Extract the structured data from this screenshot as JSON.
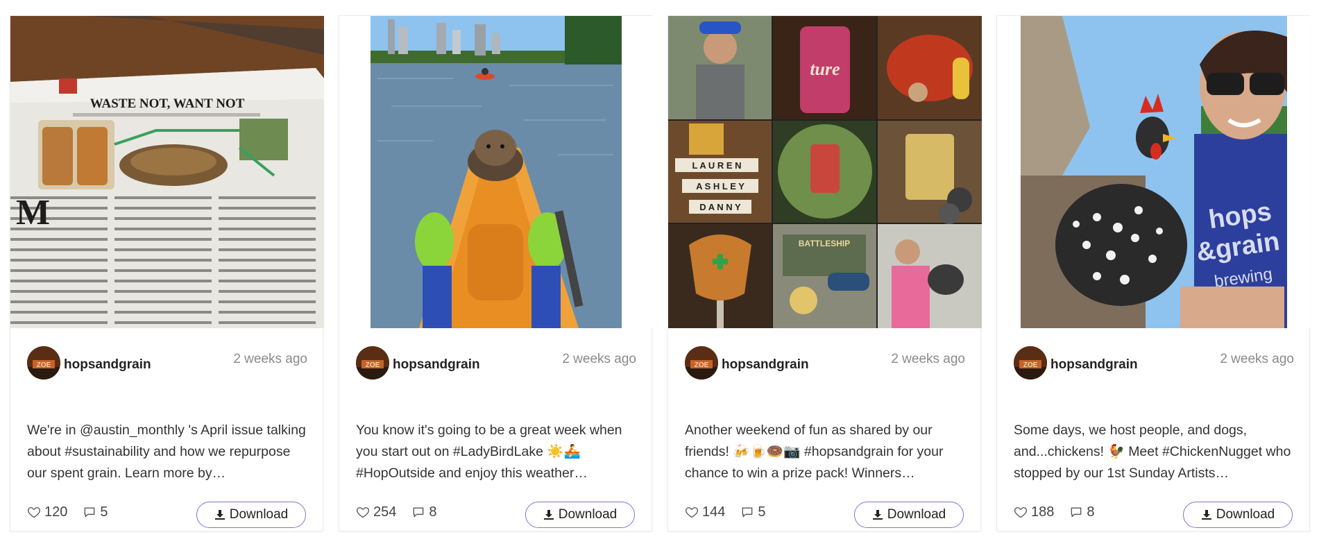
{
  "posts": [
    {
      "image_alt": "magazine page about spent grain",
      "magazine_headline": "WASTE NOT, WANT NOT",
      "username": "hopsandgrain",
      "time": "2 weeks ago",
      "caption": "We're in @austin_monthly 's April issue talking about #sustainability and how we repurpose our spent grain. Learn more by…",
      "likes": "120",
      "comments": "5",
      "download_label": "Download"
    },
    {
      "image_alt": "dog on a kayak on the lake",
      "username": "hopsandgrain",
      "time": "2 weeks ago",
      "caption": "You know it's going to be a great week when you start out on #LadyBirdLake ☀️🚣 #HopOutside and enjoy this weather…",
      "likes": "254",
      "comments": "8",
      "download_label": "Download"
    },
    {
      "image_alt": "collage of weekend photos",
      "username": "hopsandgrain",
      "time": "2 weeks ago",
      "caption": "Another weekend of fun as shared by our friends! 🍻🍺🍩📷 #hopsandgrain for your chance to win a prize pack! Winners…",
      "likes": "144",
      "comments": "5",
      "download_label": "Download"
    },
    {
      "image_alt": "woman holding a chicken",
      "username": "hopsandgrain",
      "time": "2 weeks ago",
      "caption": "Some days, we host people, and dogs, and...chickens! 🐓 Meet #ChickenNugget who stopped by our 1st Sunday Artists…",
      "likes": "188",
      "comments": "8",
      "download_label": "Download"
    }
  ],
  "icons": {
    "like": "heart-icon",
    "comment": "comment-icon",
    "download": "download-icon"
  },
  "colors": {
    "accent_border": "#8a6fd6",
    "muted_text": "#8a8a8a"
  }
}
